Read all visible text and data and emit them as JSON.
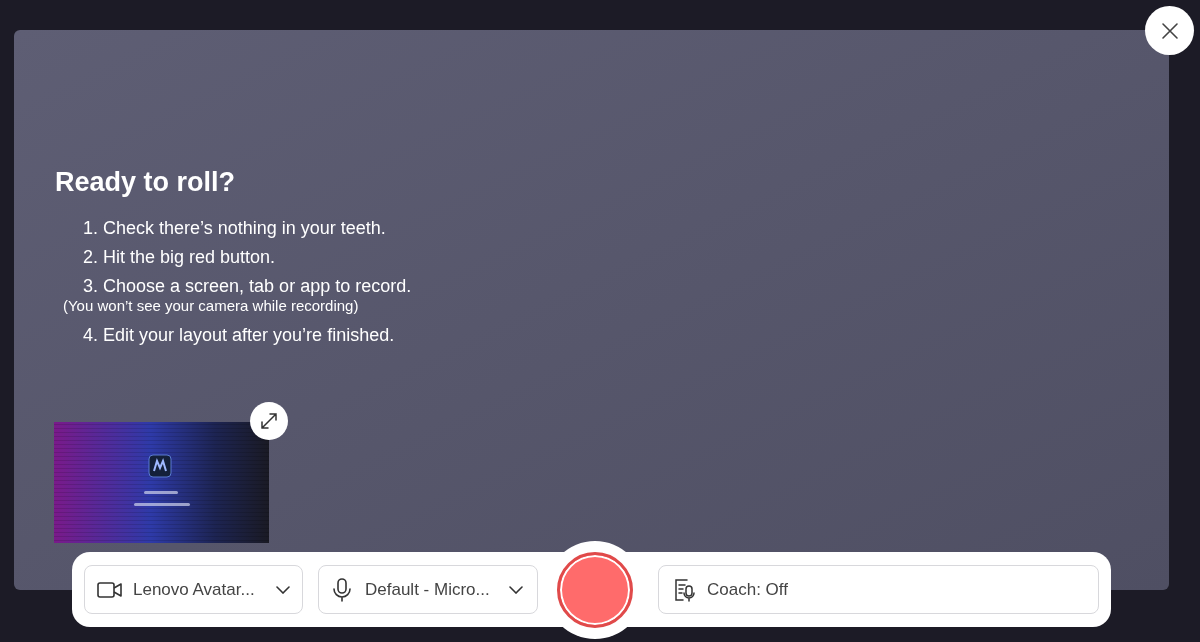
{
  "title": "Ready to roll?",
  "steps": [
    {
      "text": "1. Check there’s nothing in your teeth."
    },
    {
      "text": "2. Hit the big red button."
    },
    {
      "text": "3. Choose a screen, tab or app to record.",
      "note": "(You won’t see your camera while recording)"
    },
    {
      "text": "4. Edit your layout after you’re finished."
    }
  ],
  "controls": {
    "camera": {
      "label": "Lenovo Avatar..."
    },
    "microphone": {
      "label": "Default - Micro..."
    },
    "coach": {
      "label": "Coach: Off"
    }
  }
}
